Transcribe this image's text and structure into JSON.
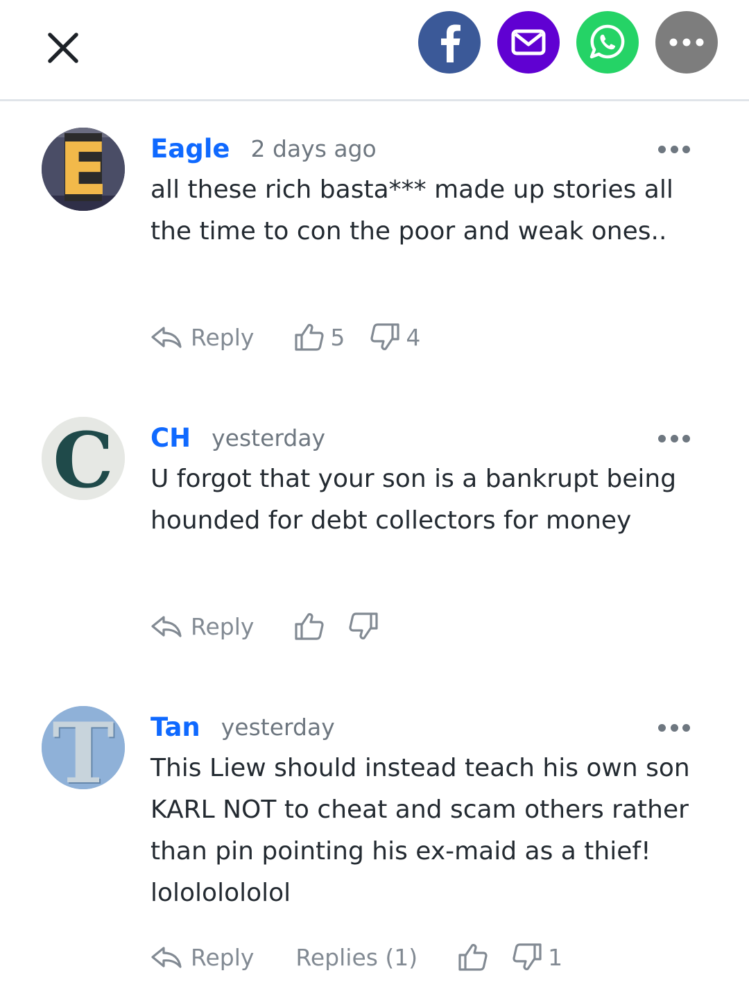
{
  "header": {
    "share_colors": {
      "facebook": "#3b5998",
      "email": "#6001d2",
      "whatsapp": "#25d366",
      "more": "#7d7d7d"
    }
  },
  "comments": [
    {
      "avatar_letter": "E",
      "author": "Eagle",
      "time": "2 days ago",
      "text": "all these rich basta*** made up stories all the time to con the poor and weak ones..",
      "reply_label": "Reply",
      "upvotes": "5",
      "downvotes": "4"
    },
    {
      "avatar_letter": "C",
      "author": "CH",
      "time": "yesterday",
      "text": "U forgot that your son is a bankrupt being hounded for debt collectors for money",
      "reply_label": "Reply",
      "upvotes": "",
      "downvotes": ""
    },
    {
      "avatar_letter": "T",
      "author": "Tan",
      "time": "yesterday",
      "text": "This Liew should instead teach his own son KARL NOT to cheat and scam others rather than pin pointing his ex-maid as a thief! lolololololol",
      "reply_label": "Reply",
      "replies_label": "Replies (1)",
      "upvotes": "",
      "downvotes": "1"
    }
  ]
}
